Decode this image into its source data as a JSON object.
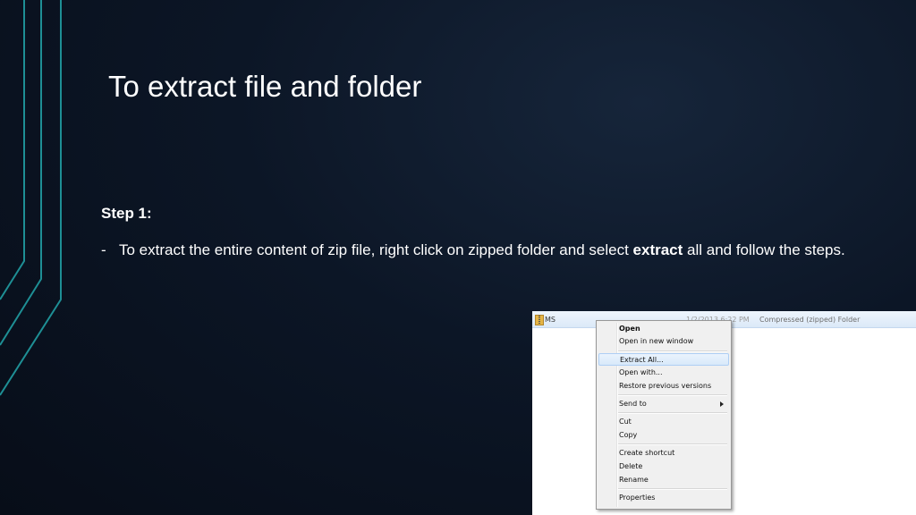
{
  "slide": {
    "title": "To extract file and folder",
    "step_heading": "Step 1:",
    "step_dash": "-",
    "step_text_before": "To extract the entire content of zip file, right click on zipped folder and select ",
    "step_text_bold": "extract",
    "step_text_after": " all and follow the steps."
  },
  "explorer": {
    "file_name": "MS",
    "file_date": "1/2/2013 6:22 PM",
    "file_type": "Compressed (zipped) Folder",
    "file_icon": "zip-folder-icon"
  },
  "context_menu": {
    "items": [
      {
        "label": "Open"
      },
      {
        "label": "Open in new window"
      },
      {
        "label": "Extract All..."
      },
      {
        "label": "Open with..."
      },
      {
        "label": "Restore previous versions"
      },
      {
        "label": "Send to"
      },
      {
        "label": "Cut"
      },
      {
        "label": "Copy"
      },
      {
        "label": "Create shortcut"
      },
      {
        "label": "Delete"
      },
      {
        "label": "Rename"
      },
      {
        "label": "Properties"
      }
    ],
    "highlighted": "Extract All..."
  },
  "colors": {
    "background": "#0c1626",
    "accent_line": "#1fa3a8",
    "menu_highlight": "#d8e9fa"
  }
}
